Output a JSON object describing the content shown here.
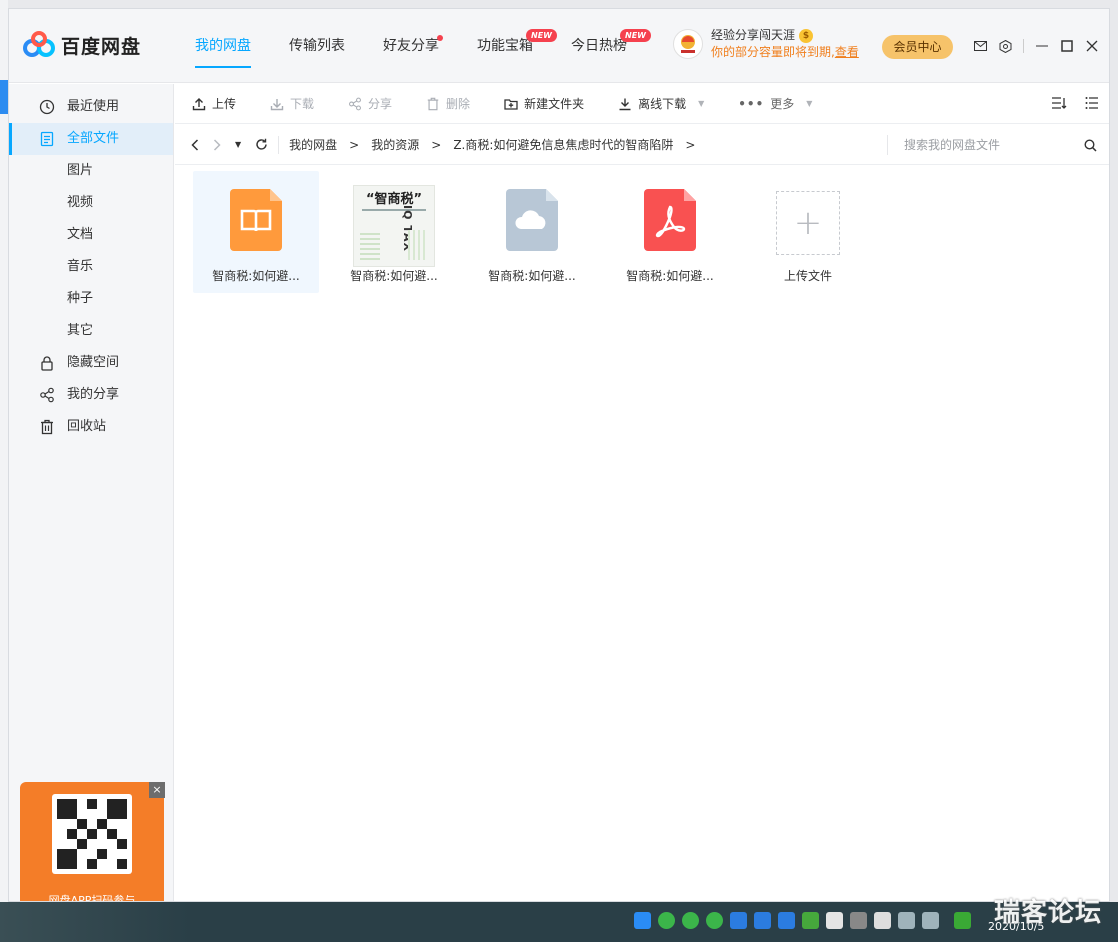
{
  "app": {
    "name": "百度网盘"
  },
  "nav": [
    {
      "label": "我的网盘",
      "active": true
    },
    {
      "label": "传输列表"
    },
    {
      "label": "好友分享",
      "dot": true
    },
    {
      "label": "功能宝箱",
      "badge": "NEW"
    },
    {
      "label": "今日热榜",
      "badge": "NEW"
    }
  ],
  "user": {
    "name": "经验分享闯天涯",
    "note": "你的部分容量即将到期,",
    "note_link": "查看",
    "coin": "$"
  },
  "vip_button": "会员中心",
  "sidebar": {
    "items": [
      {
        "label": "最近使用",
        "icon": "clock-icon"
      },
      {
        "label": "全部文件",
        "icon": "document-icon",
        "active": true
      },
      {
        "label": "图片"
      },
      {
        "label": "视频"
      },
      {
        "label": "文档"
      },
      {
        "label": "音乐"
      },
      {
        "label": "种子"
      },
      {
        "label": "其它"
      },
      {
        "label": "隐藏空间",
        "icon": "lock-icon"
      },
      {
        "label": "我的分享",
        "icon": "share-icon"
      },
      {
        "label": "回收站",
        "icon": "trash-icon"
      }
    ],
    "promo_text": "网盘APP扫码参与",
    "promo_close": "×"
  },
  "toolbar": {
    "upload": "上传",
    "download": "下载",
    "share": "分享",
    "delete": "删除",
    "new_folder": "新建文件夹",
    "offline_download": "离线下载",
    "more": "更多"
  },
  "path": {
    "crumbs": [
      "我的网盘",
      "我的资源",
      "Z.商税:如何避免信息焦虑时代的智商陷阱"
    ],
    "separator": ">",
    "search_placeholder": "搜索我的网盘文件"
  },
  "files": [
    {
      "name": "智商税:如何避...",
      "type": "ebook",
      "color": "#ff9a3c",
      "selected": true
    },
    {
      "name": "智商税:如何避...",
      "type": "image-cover",
      "cover_title": "“智商税”",
      "cover_sub": "IQ TAX"
    },
    {
      "name": "智商税:如何避...",
      "type": "unknown",
      "color": "#b8c7d6"
    },
    {
      "name": "智商税:如何避...",
      "type": "pdf",
      "color": "#f95151"
    },
    {
      "name": "上传文件",
      "type": "upload",
      "plus": "+"
    }
  ],
  "watermark": "瑞客论坛",
  "clock": "2020/10/5"
}
